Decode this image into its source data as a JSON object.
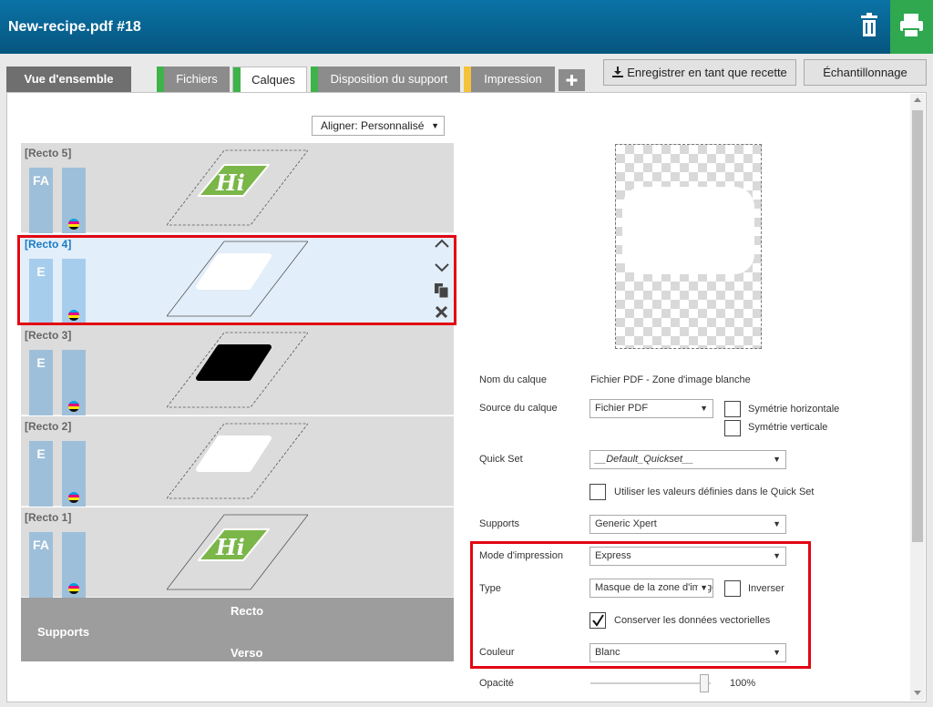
{
  "window": {
    "title": "New-recipe.pdf #18"
  },
  "header": {
    "delete_icon": "trash-icon",
    "print_icon": "printer-icon"
  },
  "tabs": [
    {
      "label": "Vue d'ensemble"
    },
    {
      "label": "Fichiers",
      "status_color": "#3db34a"
    },
    {
      "label": "Calques",
      "status_color": "#3db34a",
      "active": true
    },
    {
      "label": "Disposition du support",
      "status_color": "#3db34a"
    },
    {
      "label": "Impression",
      "status_color": "#f5c23b"
    }
  ],
  "toolbar": {
    "add_tab_icon": "plus-icon",
    "save_recipe_label": "Enregistrer en tant que recette",
    "sampling_label": "Échantillonnage"
  },
  "align": {
    "value": "Aligner: Personnalisé"
  },
  "layers": [
    {
      "name": "[Recto 5]",
      "code": "FA",
      "preview": "green-logo"
    },
    {
      "name": "[Recto 4]",
      "code": "E",
      "preview": "white-mask",
      "selected": true
    },
    {
      "name": "[Recto 3]",
      "code": "E",
      "preview": "black-mask"
    },
    {
      "name": "[Recto 2]",
      "code": "E",
      "preview": "white-mask"
    },
    {
      "name": "[Recto 1]",
      "code": "FA",
      "preview": "green-logo"
    }
  ],
  "logo_text": "Hi",
  "layer_actions": [
    "move-up-icon",
    "move-down-icon",
    "duplicate-icon",
    "delete-icon"
  ],
  "supports_footer": {
    "recto": "Recto",
    "supports": "Supports",
    "verso": "Verso"
  },
  "properties": {
    "layer_name_label": "Nom du calque",
    "layer_name_value": "Fichier PDF - Zone d'image blanche",
    "source_label": "Source du calque",
    "source_value": "Fichier PDF",
    "mirror_h_label": "Symétrie horizontale",
    "mirror_v_label": "Symétrie verticale",
    "quickset_label": "Quick Set",
    "quickset_value": "__Default_Quickset__",
    "use_quickset_label": "Utiliser les valeurs définies dans le Quick Set",
    "supports_label": "Supports",
    "supports_value": "Generic Xpert",
    "print_mode_label": "Mode d'impression",
    "print_mode_value": "Express",
    "type_label": "Type",
    "type_value": "Masque de la zone d'image",
    "invert_label": "Inverser",
    "keep_vector_label": "Conserver les données vectorielles",
    "keep_vector_checked": true,
    "color_label": "Couleur",
    "color_value": "Blanc",
    "opacity_label": "Opacité",
    "opacity_value": "100%"
  },
  "colors": {
    "header": "#06557e",
    "print_button": "#2fa84f",
    "highlight": "#e30613",
    "logo_green": "#7ab648"
  }
}
